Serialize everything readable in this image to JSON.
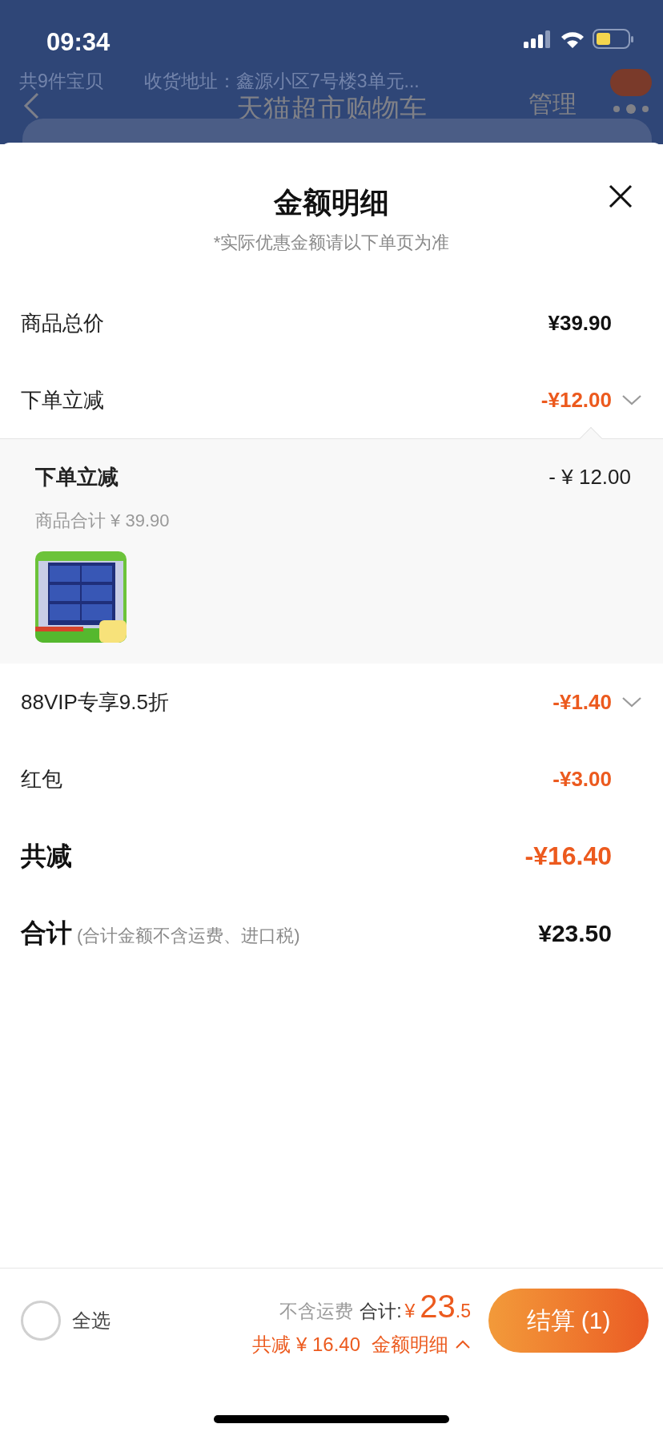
{
  "status_bar": {
    "time": "09:34"
  },
  "background_header": {
    "summary": "共9件宝贝",
    "address": "收货地址：鑫源小区7号楼3单元...",
    "title": "天猫超市购物车",
    "manage": "管理"
  },
  "sheet": {
    "title": "金额明细",
    "subtitle": "*实际优惠金额请以下单页为准",
    "rows": [
      {
        "kind": "price",
        "label": "商品总价",
        "amount": "¥39.90"
      },
      {
        "kind": "discount",
        "label": "下单立减",
        "amount": "-¥12.00",
        "detail": {
          "label": "下单立减",
          "amount": "- ¥ 12.00",
          "subtotal": "商品合计 ¥ 39.90"
        }
      },
      {
        "kind": "discount",
        "label": "88VIP专享9.5折",
        "amount": "-¥1.40"
      },
      {
        "kind": "discount_plain",
        "label": "红包",
        "amount": "-¥3.00"
      },
      {
        "kind": "total_discount",
        "label": "共减",
        "amount": "-¥16.40"
      },
      {
        "kind": "total",
        "label": "合计",
        "note": "(合计金额不含运费、进口税)",
        "amount": "¥23.50"
      }
    ]
  },
  "bottom_bar": {
    "select_all": {
      "label": "全选",
      "checked": false
    },
    "shipping_note": "不含运费",
    "total_label": "合计:",
    "currency": "¥",
    "total_int": "23",
    "total_dec": ".5",
    "discount": "共减 ¥ 16.40",
    "details_link": "金额明细",
    "checkout": "结算 (1)"
  }
}
